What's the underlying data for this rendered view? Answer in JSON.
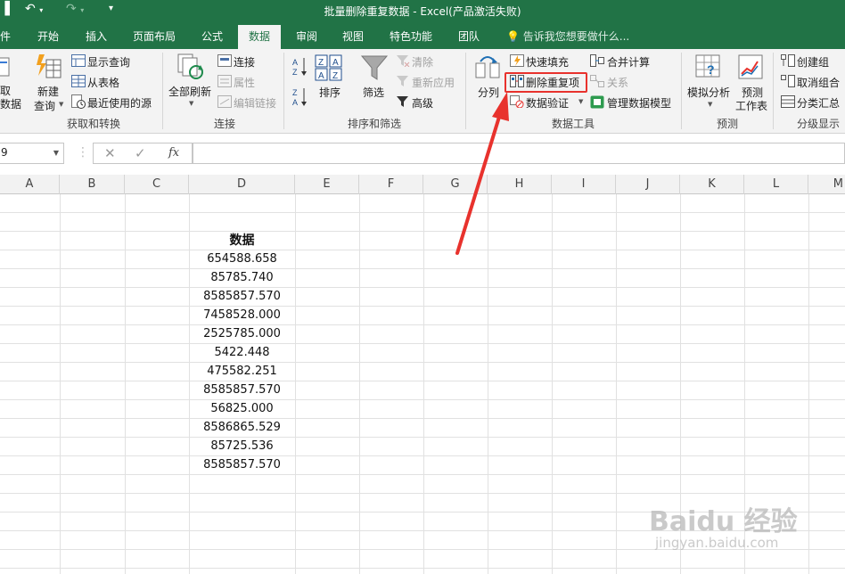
{
  "window": {
    "title": "批量删除重复数据 - Excel(产品激活失败)"
  },
  "tabs": [
    "件",
    "开始",
    "插入",
    "页面布局",
    "公式",
    "数据",
    "审阅",
    "视图",
    "特色功能",
    "团队"
  ],
  "active_tab": "数据",
  "tell_me": "告诉我您想要做什么...",
  "ribbon": {
    "get_transform": {
      "label": "获取和转换",
      "get_data_a": "取",
      "get_data_b": "数据",
      "new_query_a": "新建",
      "new_query_b": "查询",
      "show_query": "显示查询",
      "from_table": "从表格",
      "recent_sources": "最近使用的源"
    },
    "connections": {
      "label": "连接",
      "refresh_all": "全部刷新",
      "connections": "连接",
      "properties": "属性",
      "edit_links": "编辑链接"
    },
    "sort_filter": {
      "label": "排序和筛选",
      "sort": "排序",
      "filter": "筛选",
      "clear": "清除",
      "reapply": "重新应用",
      "advanced": "高级"
    },
    "data_tools": {
      "label": "数据工具",
      "split": "分列",
      "flash_fill": "快速填充",
      "remove_dup": "删除重复项",
      "validation": "数据验证",
      "consolidate": "合并计算",
      "relationships": "关系",
      "manage_model": "管理数据模型"
    },
    "forecast": {
      "label": "预测",
      "whatif": "模拟分析",
      "sheet_a": "预测",
      "sheet_b": "工作表"
    },
    "outline": {
      "label": "分级显示",
      "group": "创建组",
      "ungroup": "取消组合",
      "subtotal": "分类汇总"
    }
  },
  "namebox": "9",
  "columns": [
    "A",
    "B",
    "C",
    "D",
    "E",
    "F",
    "G",
    "H",
    "I",
    "J",
    "K",
    "L",
    "M"
  ],
  "cells": {
    "header": "数据",
    "values": [
      "654588.658",
      "85785.740",
      "8585857.570",
      "7458528.000",
      "2525785.000",
      "5422.448",
      "475582.251",
      "8585857.570",
      "56825.000",
      "8586865.529",
      "85725.536",
      "8585857.570"
    ]
  },
  "colors": {
    "excel_green": "#217346",
    "highlight": "#e8322d"
  },
  "watermark": {
    "brand": "Baidu 经验",
    "url": "jingyan.baidu.com"
  }
}
